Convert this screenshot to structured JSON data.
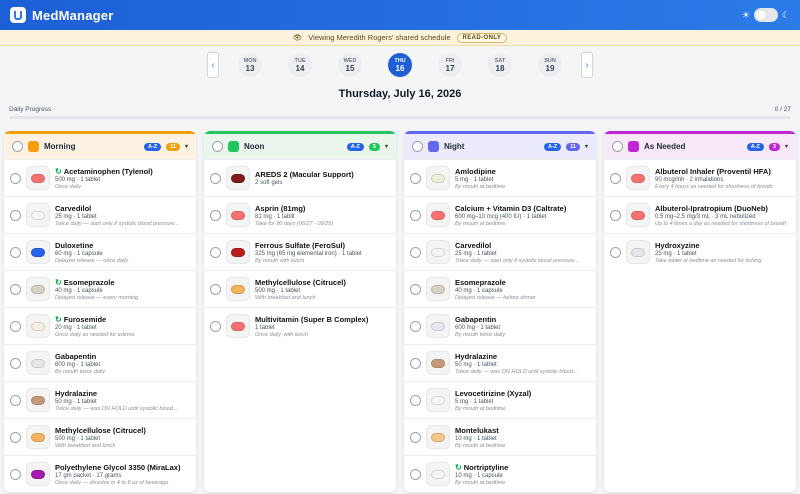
{
  "app": {
    "title": "MedManager"
  },
  "banner": {
    "text": "Viewing Meredith Rogers' shared schedule",
    "badge": "READ-ONLY"
  },
  "week": [
    {
      "dn": "MON",
      "dd": "13",
      "sel": false
    },
    {
      "dn": "TUE",
      "dd": "14",
      "sel": false
    },
    {
      "dn": "WED",
      "dd": "15",
      "sel": false
    },
    {
      "dn": "THU",
      "dd": "16",
      "sel": true
    },
    {
      "dn": "FRI",
      "dd": "17",
      "sel": false
    },
    {
      "dn": "SAT",
      "dd": "18",
      "sel": false
    },
    {
      "dn": "SUN",
      "dd": "19",
      "sel": false
    }
  ],
  "date": "Thursday, July 16, 2026",
  "progress": {
    "label": "Daily Progress",
    "value": "0 / 27",
    "fraction": 0
  },
  "columns": [
    {
      "title": "Morning",
      "color": "#f59e0b",
      "bg": "#fdf1e2",
      "count": "11",
      "az": "A-Z",
      "rows": [
        {
          "nm": "Acetaminophen (Tylenol)",
          "ds": "500 mg · 1 tablet",
          "nt": "Once daily",
          "rf": true,
          "pc": "#f87171"
        },
        {
          "nm": "Carvedilol",
          "ds": "25 mg · 1 tablet",
          "nt": "Twice daily — start only if systolic blood pressure...",
          "rf": false,
          "pc": "#f3f4f6"
        },
        {
          "nm": "Duloxetine",
          "ds": "60 mg · 1 capsule",
          "nt": "Delayed release — once daily",
          "rf": false,
          "pc": "#2563eb"
        },
        {
          "nm": "Esomeprazole",
          "ds": "40 mg · 1 capsule",
          "nt": "Delayed release — every morning",
          "rf": true,
          "pc": "#d6d3c4"
        },
        {
          "nm": "Furosemide",
          "ds": "20 mg · 1 tablet",
          "nt": "Once daily as needed for edema",
          "rf": true,
          "pc": "#f3efe0"
        },
        {
          "nm": "Gabapentin",
          "ds": "600 mg · 1 tablet",
          "nt": "By mouth twice daily",
          "rf": false,
          "pc": "#e5e7eb"
        },
        {
          "nm": "Hydralazine",
          "ds": "50 mg · 1 tablet",
          "nt": "Twice daily — was ON HOLD until systolic blood...",
          "rf": false,
          "pc": "#c49a7a"
        },
        {
          "nm": "Methylcellulose (Citrucel)",
          "ds": "500 mg · 1 tablet",
          "nt": "With breakfast and lunch",
          "rf": false,
          "pc": "#f1b35b"
        },
        {
          "nm": "Polyethylene Glycol 3350 (MiraLax)",
          "ds": "17 gm packet · 17 grams",
          "nt": "Once daily — dissolve in 4 to 8 oz of beverage",
          "rf": false,
          "pc": "#a21caf"
        }
      ]
    },
    {
      "title": "Noon",
      "color": "#22c55e",
      "bg": "#eaf6ec",
      "count": "5",
      "az": "A-Z",
      "rows": [
        {
          "nm": "AREDS 2 (Macular Support)",
          "ds": "2 soft gels",
          "nt": "",
          "rf": false,
          "pc": "#7f1d1d"
        },
        {
          "nm": "Asprin (81mg)",
          "ds": "81 mg · 1 tablit",
          "nt": "Take for 90 days (06/27 - 09/25)",
          "rf": false,
          "pc": "#f87171"
        },
        {
          "nm": "Ferrous Sulfate (FeroSul)",
          "ds": "325 mg (65 mg elemental iron) · 1 tablet",
          "nt": "By mouth with lunch",
          "rf": false,
          "pc": "#b91c1c"
        },
        {
          "nm": "Methylcellulose (Citrucel)",
          "ds": "500 mg · 1 tablet",
          "nt": "With breakfast and lunch",
          "rf": false,
          "pc": "#f1b35b"
        },
        {
          "nm": "Multivitamin (Super B Complex)",
          "ds": "1 tablet",
          "nt": "Once daily, with lunch",
          "rf": false,
          "pc": "#f87171"
        }
      ]
    },
    {
      "title": "Night",
      "color": "#6366f1",
      "bg": "#ecebfb",
      "count": "11",
      "az": "A-Z",
      "rows": [
        {
          "nm": "Amlodipine",
          "ds": "5 mg · 1 tablet",
          "nt": "By mouth at bedtime",
          "rf": false,
          "pc": "#ecefd8"
        },
        {
          "nm": "Calcium + Vitamin D3 (Caltrate)",
          "ds": "600 mg–10 mcg (400 IU) · 1 tablet",
          "nt": "By mouth at bedtime",
          "rf": false,
          "pc": "#f87171"
        },
        {
          "nm": "Carvedilol",
          "ds": "25 mg · 1 tablet",
          "nt": "Twice daily — start only if systolic blood pressure...",
          "rf": false,
          "pc": "#f3f4f6"
        },
        {
          "nm": "Esomeprazole",
          "ds": "40 mg · 1 capsule",
          "nt": "Delayed release — before dinner",
          "rf": false,
          "pc": "#d6d3c4"
        },
        {
          "nm": "Gabapentin",
          "ds": "600 mg · 1 tablet",
          "nt": "By mouth twice daily",
          "rf": false,
          "pc": "#e5e7eb"
        },
        {
          "nm": "Hydralazine",
          "ds": "50 mg · 1 tablet",
          "nt": "Twice daily — was ON HOLD until systolic blood...",
          "rf": false,
          "pc": "#c49a7a"
        },
        {
          "nm": "Levocetirizine (Xyzal)",
          "ds": "5 mg · 1 tablet",
          "nt": "By mouth at bedtime",
          "rf": false,
          "pc": "#f3f4f6"
        },
        {
          "nm": "Montelukast",
          "ds": "10 mg · 1 tablet",
          "nt": "By mouth at bedtime",
          "rf": false,
          "pc": "#f3c68a"
        },
        {
          "nm": "Nortriptyline",
          "ds": "10 mg · 1 capsule",
          "nt": "By mouth at bedtime",
          "rf": true,
          "pc": "#f3f4f6"
        }
      ]
    },
    {
      "title": "As Needed",
      "color": "#c026d3",
      "bg": "#f7e9f8",
      "count": "3",
      "az": "A-Z",
      "rows": [
        {
          "nm": "Albuterol Inhaler (Proventil HFA)",
          "ds": "90 mcg/inh · 2 inhalations",
          "nt": "Every 4 hours as needed for shortness of breath",
          "rf": false,
          "pc": "#f87171"
        },
        {
          "nm": "Albuterol-Ipratropium (DuoNeb)",
          "ds": "0.5 mg–2.5 mg/3 mL · 3 mL nebulized",
          "nt": "Up to 4 times a day as needed for shortness of breath",
          "rf": false,
          "pc": "#f87171"
        },
        {
          "nm": "Hydroxyzine",
          "ds": "25 mg · 1 tablet",
          "nt": "Take tablet at bedtime as needed for itching",
          "rf": false,
          "pc": "#e5e7eb"
        }
      ]
    }
  ]
}
